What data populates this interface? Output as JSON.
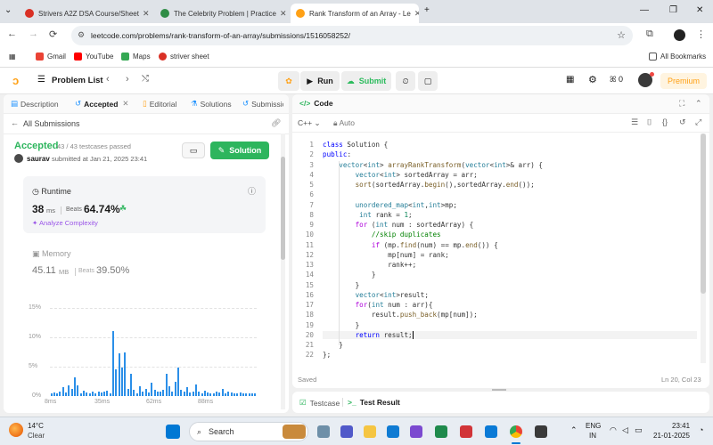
{
  "browser": {
    "tabs": [
      {
        "title": "Strivers A2Z DSA Course/Sheet",
        "favicon_color": "#d93025"
      },
      {
        "title": "The Celebrity Problem | Practice",
        "favicon_color": "#2f8d46"
      },
      {
        "title": "Rank Transform of an Array - Le",
        "favicon_color": "#ffa116"
      }
    ],
    "url": "leetcode.com/problems/rank-transform-of-an-array/submissions/1516058252/",
    "bookmarks": [
      "Gmail",
      "YouTube",
      "Maps",
      "striver sheet"
    ],
    "all_bookmarks": "All Bookmarks"
  },
  "header": {
    "problem_list": "Problem List",
    "run": "Run",
    "submit": "Submit",
    "streak": "0",
    "premium": "Premium"
  },
  "left": {
    "tabs": [
      "Description",
      "Accepted",
      "Editorial",
      "Solutions",
      "Submissions"
    ],
    "all_submissions": "All Submissions",
    "status": "Accepted",
    "testcases": "43 / 43 testcases passed",
    "user": "saurav",
    "submitted": "submitted at Jan 21, 2025 23:41",
    "solution_btn": "Solution",
    "runtime_label": "Runtime",
    "runtime_value": "38",
    "runtime_unit": "ms",
    "beats_label": "Beats",
    "runtime_beats": "64.74%",
    "analyze": "Analyze Complexity",
    "memory_label": "Memory",
    "memory_value": "45.11",
    "memory_unit": "MB",
    "memory_beats": "39.50%",
    "yticks": [
      "15%",
      "10%",
      "5%",
      "0%"
    ],
    "xticks": [
      "8ms",
      "35ms",
      "62ms",
      "88ms"
    ]
  },
  "chart_data": {
    "type": "bar",
    "x_range": [
      8,
      100
    ],
    "ylim": [
      0,
      15
    ],
    "yticks": [
      "15%",
      "10%",
      "5%",
      "0%"
    ],
    "xticks": [
      "8ms",
      "35ms",
      "62ms",
      "88ms"
    ],
    "values": [
      0.5,
      0.6,
      0.5,
      0.8,
      1.5,
      0.6,
      1.8,
      1.2,
      3.2,
      1.8,
      0.5,
      0.9,
      0.6,
      0.5,
      0.7,
      0.5,
      0.8,
      0.6,
      0.7,
      0.9,
      0.5,
      11,
      4.5,
      7.2,
      4.8,
      7.5,
      1.2,
      3.8,
      1.0,
      0.5,
      1.6,
      0.8,
      1.2,
      0.6,
      2.2,
      1.0,
      0.7,
      0.8,
      1.0,
      3.8,
      1.6,
      0.8,
      2.4,
      4.8,
      1.0,
      0.8,
      1.5,
      0.6,
      0.8,
      2.0,
      0.7,
      0.5,
      0.9,
      0.6,
      0.5,
      0.4,
      0.8,
      0.6,
      1.2,
      0.5,
      0.7,
      0.6,
      0.5,
      0.5,
      0.6,
      0.5,
      0.4,
      0.5,
      0.5,
      0.4
    ]
  },
  "editor": {
    "title": "Code",
    "language": "C++",
    "auto": "Auto",
    "saved": "Saved",
    "cursor": "Ln 20, Col 23",
    "testcase": "Testcase",
    "test_result": "Test Result"
  },
  "code": [
    "class Solution {",
    "public:",
    "    vector<int> arrayRankTransform(vector<int>& arr) {",
    "        vector<int> sortedArray = arr;",
    "        sort(sortedArray.begin(),sortedArray.end());",
    "",
    "        unordered_map<int,int>mp;",
    "         int rank = 1;",
    "        for (int num : sortedArray) {",
    "            //skip duplicates",
    "            if (mp.find(num) == mp.end()) {",
    "                mp[num] = rank;",
    "                rank++;",
    "            }",
    "        }",
    "        vector<int>result;",
    "        for(int num : arr){",
    "            result.push_back(mp[num]);",
    "        }",
    "        return result;",
    "    }",
    "};"
  ],
  "taskbar": {
    "temp": "14°C",
    "weather": "Clear",
    "search": "Search",
    "lang1": "ENG",
    "lang2": "IN",
    "time": "23:41",
    "date": "21-01-2025"
  }
}
